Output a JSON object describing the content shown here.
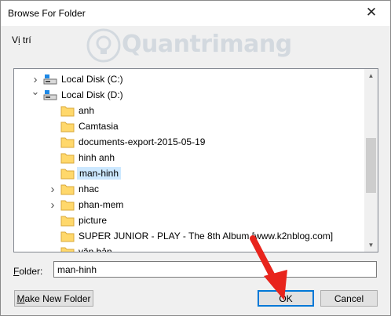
{
  "window": {
    "title": "Browse For Folder",
    "close_glyph": "✕"
  },
  "description": "Vị trí",
  "watermark": {
    "text": "Quantrimang"
  },
  "tree": {
    "items": [
      {
        "label": "Local Disk (C:)",
        "icon": "drive-icon",
        "expander": "collapsed",
        "level": 1
      },
      {
        "label": "Local Disk (D:)",
        "icon": "drive-icon",
        "expander": "expanded",
        "level": 1
      },
      {
        "label": "anh",
        "icon": "folder-icon",
        "expander": "none",
        "level": 2
      },
      {
        "label": "Camtasia",
        "icon": "folder-icon",
        "expander": "none",
        "level": 2
      },
      {
        "label": "documents-export-2015-05-19",
        "icon": "folder-icon",
        "expander": "none",
        "level": 2
      },
      {
        "label": "hinh anh",
        "icon": "folder-icon",
        "expander": "none",
        "level": 2
      },
      {
        "label": "man-hinh",
        "icon": "folder-icon",
        "expander": "none",
        "level": 2,
        "selected": true
      },
      {
        "label": "nhac",
        "icon": "folder-icon",
        "expander": "collapsed",
        "level": 2
      },
      {
        "label": "phan-mem",
        "icon": "folder-icon",
        "expander": "collapsed",
        "level": 2
      },
      {
        "label": "picture",
        "icon": "folder-icon",
        "expander": "none",
        "level": 2
      },
      {
        "label": "SUPER JUNIOR - PLAY - The 8th Album [www.k2nblog.com]",
        "icon": "folder-icon",
        "expander": "none",
        "level": 2
      },
      {
        "label": "văn bản",
        "icon": "folder-icon",
        "expander": "none",
        "level": 2
      }
    ]
  },
  "folder_field": {
    "label": "Folder:",
    "mnemonic": "F",
    "rest": "older:",
    "value": "man-hinh"
  },
  "buttons": {
    "make_new_folder": "Make New Folder",
    "make_new_folder_mnemonic": "M",
    "make_new_folder_rest": "ake New Folder",
    "ok": "OK",
    "cancel": "Cancel"
  },
  "colors": {
    "selection": "#cce8ff",
    "folder": "#ffd86b",
    "default_button_border": "#0078d7",
    "annotation_arrow": "#e8241c"
  }
}
